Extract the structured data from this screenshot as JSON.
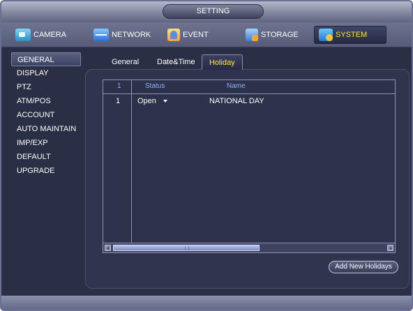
{
  "window": {
    "title": "SETTING"
  },
  "main_tabs": [
    {
      "label": "CAMERA",
      "icon": "camera-icon",
      "active": false
    },
    {
      "label": "NETWORK",
      "icon": "network-icon",
      "active": false
    },
    {
      "label": "EVENT",
      "icon": "event-icon",
      "active": false
    },
    {
      "label": "STORAGE",
      "icon": "storage-icon",
      "active": false
    },
    {
      "label": "SYSTEM",
      "icon": "system-icon",
      "active": true
    }
  ],
  "left_menu": [
    {
      "label": "GENERAL",
      "active": true
    },
    {
      "label": "DISPLAY",
      "active": false
    },
    {
      "label": "PTZ",
      "active": false
    },
    {
      "label": "ATM/POS",
      "active": false
    },
    {
      "label": "ACCOUNT",
      "active": false
    },
    {
      "label": "AUTO MAINTAIN",
      "active": false
    },
    {
      "label": "IMP/EXP",
      "active": false
    },
    {
      "label": "DEFAULT",
      "active": false
    },
    {
      "label": "UPGRADE",
      "active": false
    }
  ],
  "sub_tabs": [
    {
      "label": "General",
      "active": false
    },
    {
      "label": "Date&Time",
      "active": false
    },
    {
      "label": "Holiday",
      "active": true
    }
  ],
  "table": {
    "header": {
      "index": "1",
      "status": "Status",
      "name": "Name"
    },
    "rows": [
      {
        "index": "1",
        "status": "Open",
        "name": "NATIONAL DAY"
      }
    ]
  },
  "buttons": {
    "add_label": "Add New Holidays"
  },
  "colors": {
    "accent": "#ffe14a",
    "header_text": "#8fb3ff",
    "background": "#2b2f45"
  }
}
